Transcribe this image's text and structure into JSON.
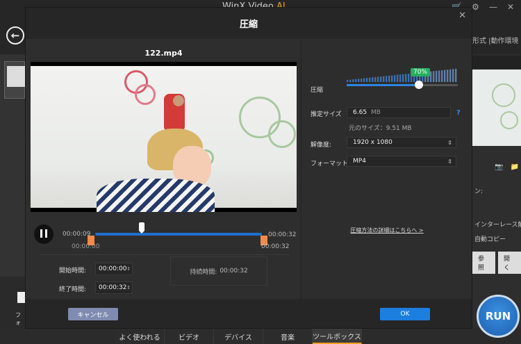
{
  "app": {
    "title": "WinX Video",
    "title_ai": "AI",
    "format_link": "形式 |動作環境 >",
    "run_label": "RUN",
    "left_label": "フォ",
    "right_panel": {
      "label1": "ン:",
      "option1": "インターレース解除",
      "option2": "自動コピー",
      "browse": "参照",
      "open": "開く"
    },
    "bottom_tabs": [
      "よく使われる",
      "ビデオ",
      "デバイス",
      "音楽",
      "ツールボックス"
    ],
    "active_tab": "ツールボックス"
  },
  "dialog": {
    "title": "圧縮",
    "file_name": "122.mp4",
    "timeline": {
      "current": "00:00:09",
      "start": "00:00:00",
      "end_top": "00:00:32",
      "end_bottom": "00:00:32",
      "position_fraction": 0.28
    },
    "start_time_label": "開始時間:",
    "start_time_value": "00:00:00",
    "end_time_label": "終了時間:",
    "end_time_value": "00:00:32",
    "duration_label": "持続時間:",
    "duration_value": "00:00:32",
    "compress_label": "圧縮",
    "compress_percent": "70%",
    "compress_value": 0.7,
    "estimated_size_label": "推定サイズ",
    "estimated_size_value": "6.65",
    "estimated_size_unit": "MB",
    "help_icon": "?",
    "original_size": "元のサイズ：9.51 MB",
    "resolution_label": "解像度:",
    "resolution_value": "1920 x 1080",
    "format_label": "フォーマット:",
    "format_value": "MP4",
    "detail_link": "圧縮方法の詳細はこちらへ >",
    "cancel_label": "キャンセル",
    "ok_label": "OK",
    "accent_color": "#1c7fe0",
    "badge_color": "#27ae60"
  }
}
